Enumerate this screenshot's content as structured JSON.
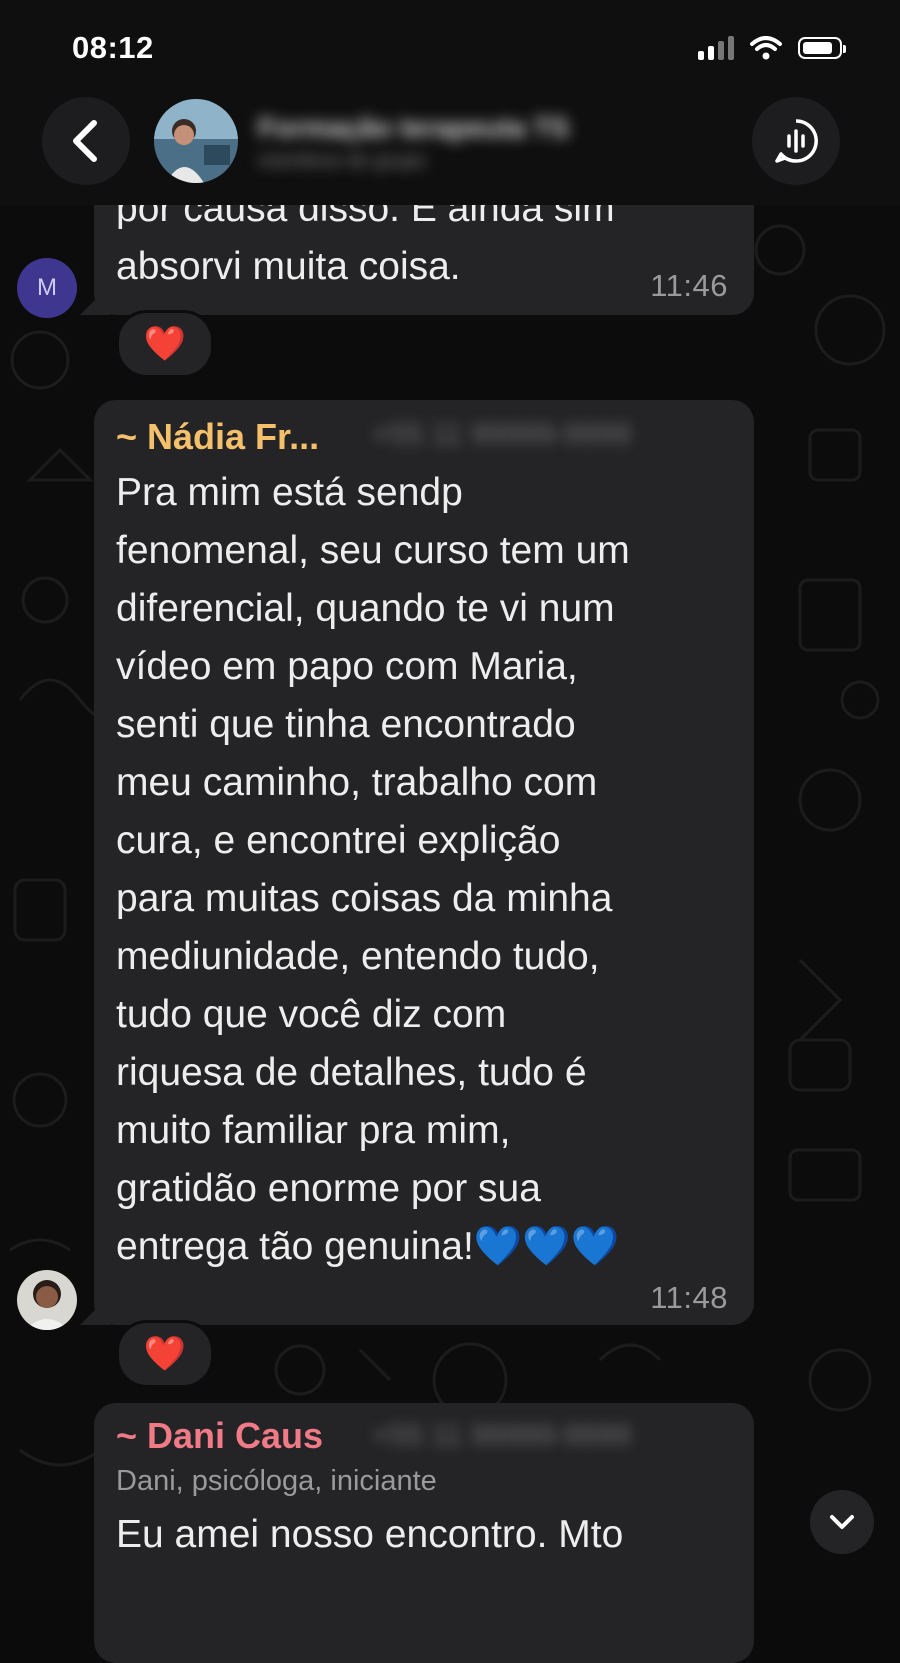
{
  "status_bar": {
    "time": "08:12"
  },
  "header": {
    "chat_title": "Formação terapeuta TS",
    "chat_subtitle": "membros do grupo"
  },
  "messages": [
    {
      "text": "por causa disso. E ainda sim\nabsorvi muita coisa.",
      "time": "11:46",
      "sender_initial": "M",
      "reaction": "❤️"
    },
    {
      "sender_name": "~ Nádia Fr...",
      "sender_phone": "+55 11 99999-9999",
      "text": "Pra mim está sendp\nfenomenal, seu curso tem um\ndiferencial, quando te vi num\nvídeo em papo com Maria,\nsenti que tinha encontrado\nmeu caminho, trabalho com\ncura, e encontrei explição\npara muitas coisas da minha\nmediunidade, entendo tudo,\ntudo que você diz com\nriquesa de detalhes, tudo é\nmuito familiar pra mim,\ngratidão enorme por sua\nentrega tão genuina!💙💙💙",
      "time": "11:48",
      "reaction": "❤️"
    },
    {
      "sender_name": "~ Dani Caus",
      "sender_phone": "+55 11 99999-9999",
      "sender_subtitle": "Dani, psicóloga, iniciante",
      "text": "Eu amei nosso encontro. Mto"
    }
  ],
  "colors": {
    "nadia_name": "#f5c06b",
    "dani_name": "#f07a86"
  },
  "icons": {
    "back": "chevron-left-icon",
    "call": "voice-chat-icon",
    "scroll": "chevron-down-icon"
  }
}
